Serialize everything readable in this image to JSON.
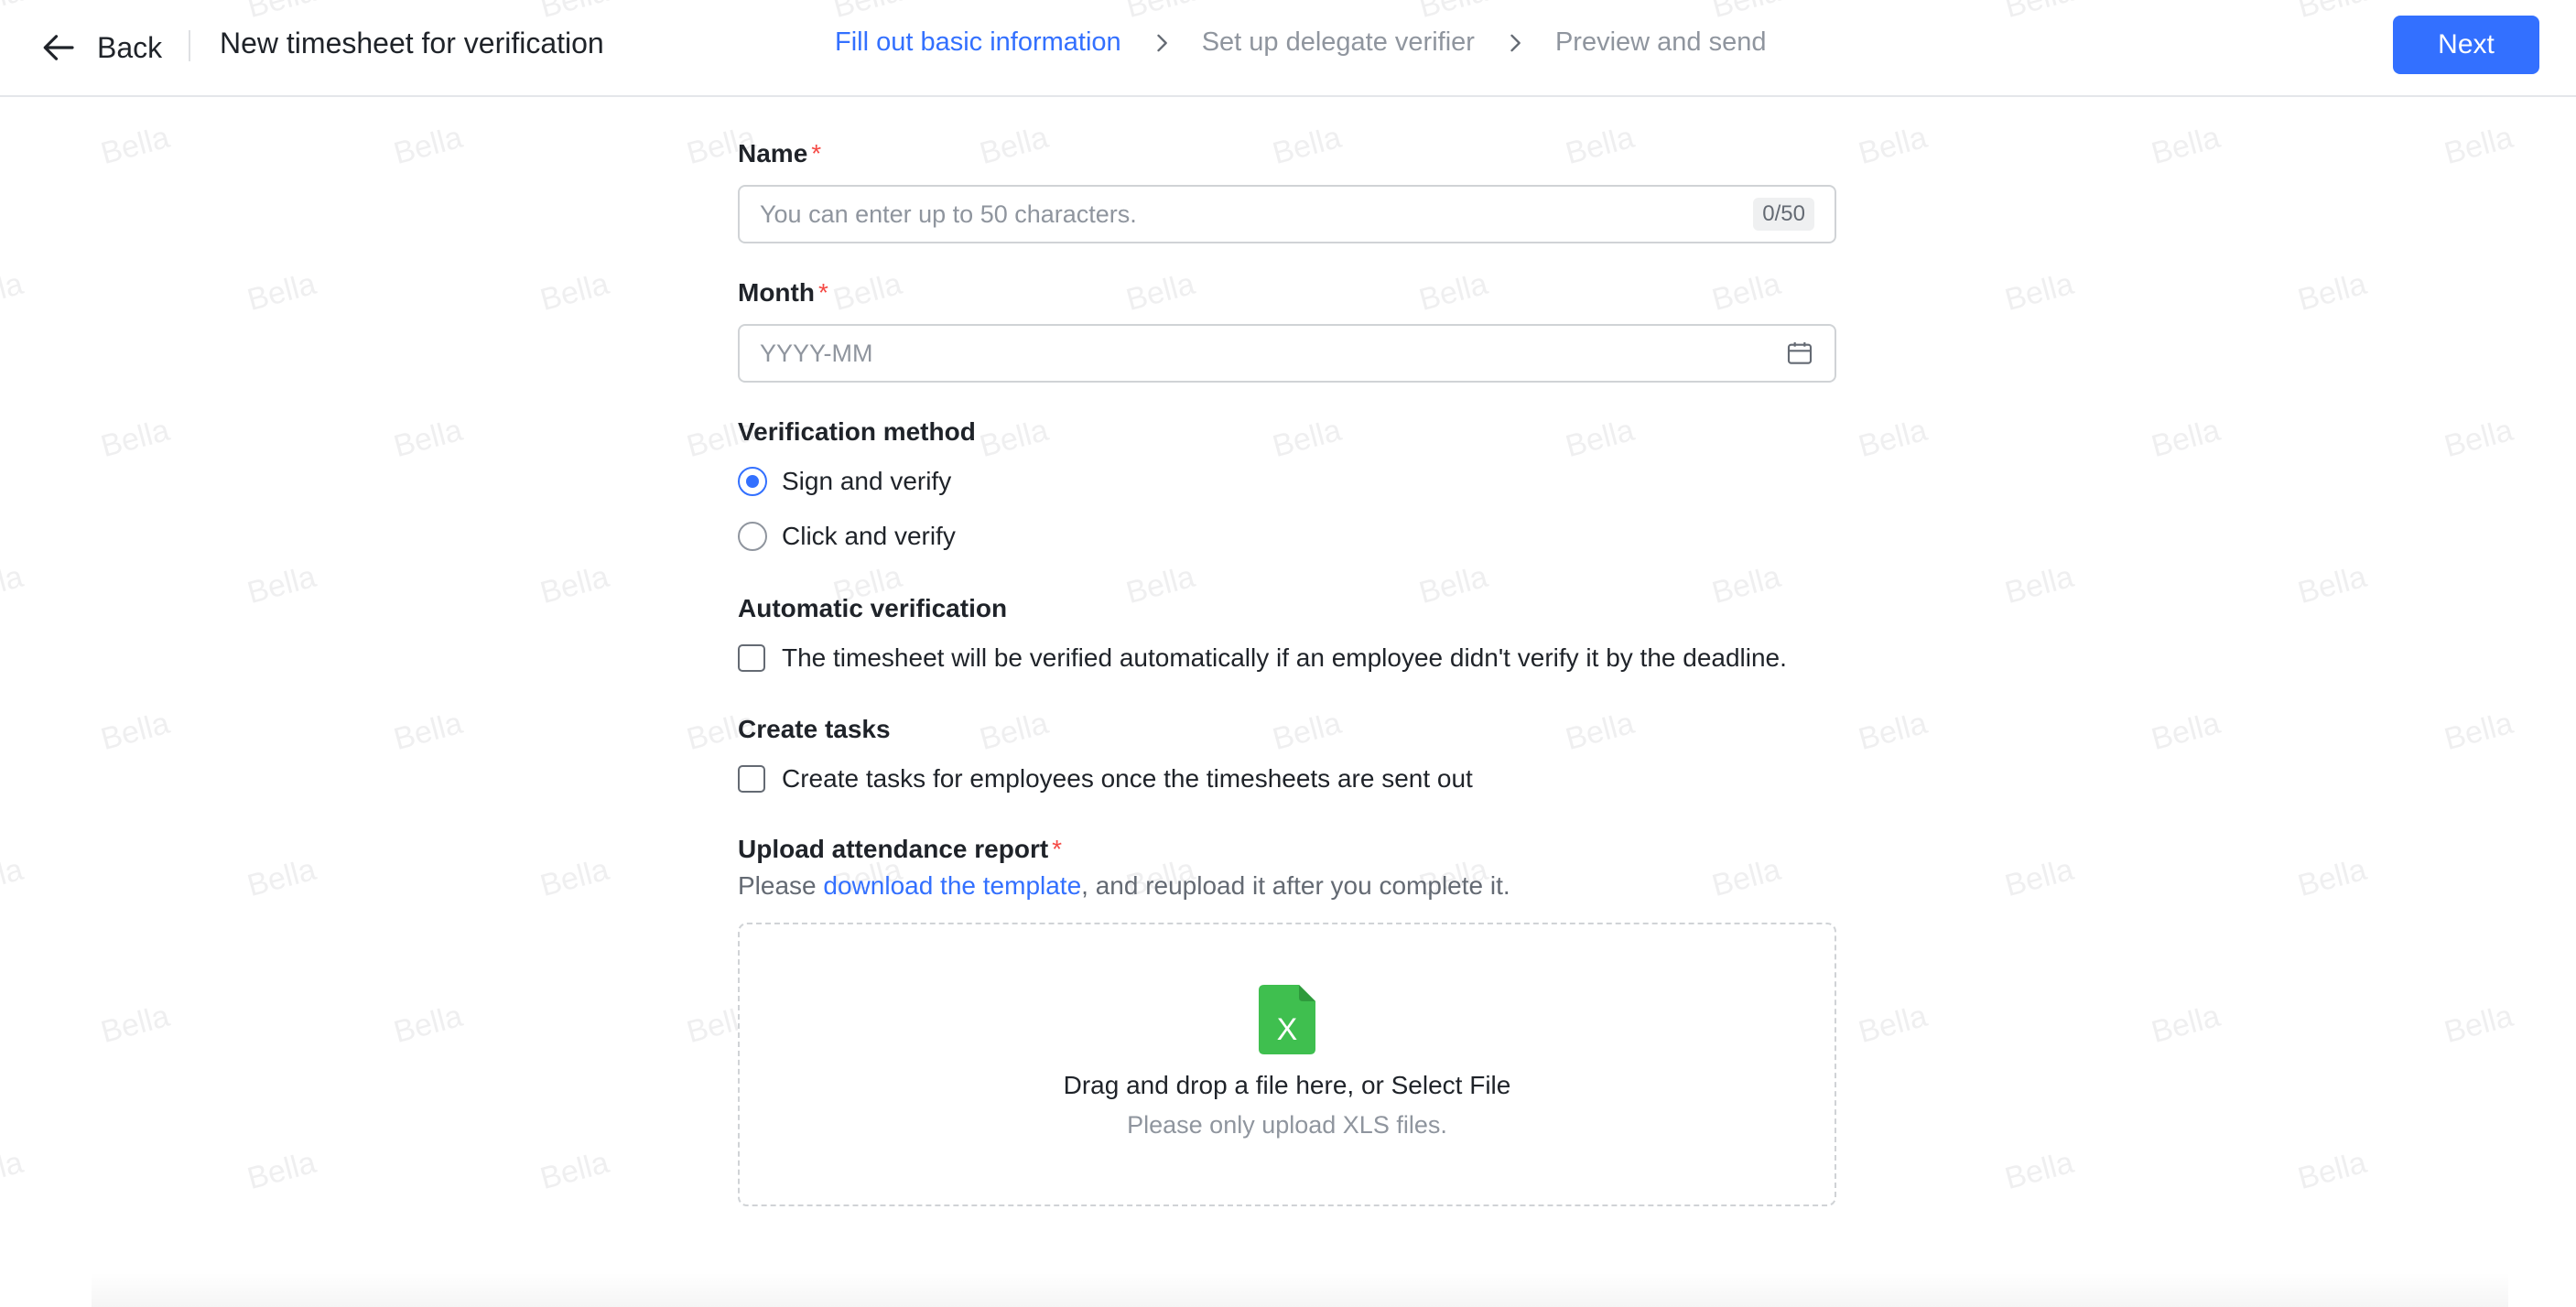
{
  "header": {
    "back_label": "Back",
    "title": "New timesheet for verification",
    "steps": [
      {
        "label": "Fill out basic information",
        "active": true
      },
      {
        "label": "Set up delegate verifier",
        "active": false
      },
      {
        "label": "Preview and send",
        "active": false
      }
    ],
    "next_label": "Next"
  },
  "watermark_text": "Bella",
  "form": {
    "name": {
      "label": "Name",
      "required": "*",
      "placeholder": "You can enter up to 50 characters.",
      "value": "",
      "counter": "0/50"
    },
    "month": {
      "label": "Month",
      "required": "*",
      "placeholder": "YYYY-MM",
      "value": ""
    },
    "verification_method": {
      "label": "Verification method",
      "options": [
        {
          "label": "Sign and verify",
          "checked": true
        },
        {
          "label": "Click and verify",
          "checked": false
        }
      ]
    },
    "automatic_verification": {
      "label": "Automatic verification",
      "checkbox_label": "The timesheet will be verified automatically if an employee didn't verify it by the deadline.",
      "checked": false
    },
    "create_tasks": {
      "label": "Create tasks",
      "checkbox_label": "Create tasks for employees once the timesheets are sent out",
      "checked": false
    },
    "upload": {
      "label": "Upload attendance report",
      "required": "*",
      "hint_prefix": "Please ",
      "hint_link": "download the template",
      "hint_suffix": ", and reupload it after you complete it.",
      "file_icon_letter": "X",
      "drop_text": "Drag and drop a file here, or Select File",
      "drop_subtext": "Please only upload XLS files."
    }
  },
  "colors": {
    "accent": "#3370ff",
    "required": "#f54a45",
    "xls_green": "#3fbf4f"
  }
}
